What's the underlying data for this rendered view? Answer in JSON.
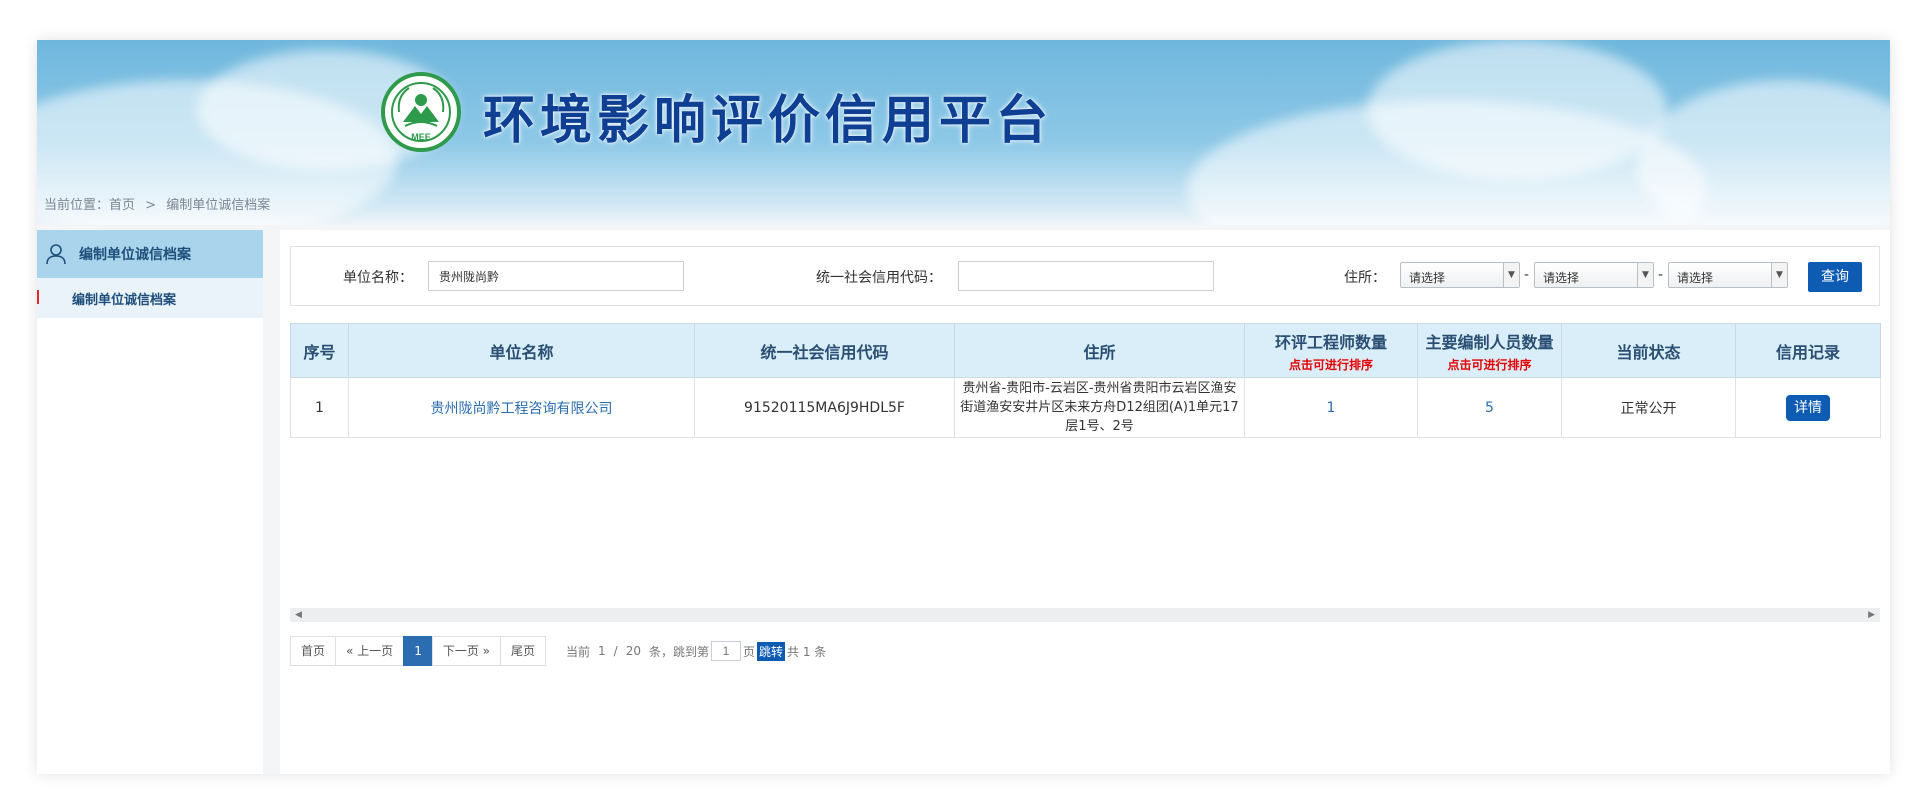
{
  "banner": {
    "title": "环境影响评价信用平台",
    "logo_text": "MEE"
  },
  "breadcrumb": {
    "prefix": "当前位置：",
    "home": "首页",
    "separator": ">",
    "current": "编制单位诚信档案"
  },
  "sidebar": {
    "header": "编制单位诚信档案",
    "items": [
      {
        "label": "编制单位诚信档案"
      }
    ]
  },
  "filter": {
    "unit_name_label": "单位名称：",
    "unit_name_value": "贵州陇尚黔",
    "credit_code_label": "统一社会信用代码：",
    "credit_code_value": "",
    "address_label": "住所：",
    "province": "请选择",
    "city": "请选择",
    "district": "请选择",
    "dash": "-",
    "query_label": "查询"
  },
  "table": {
    "headers": {
      "index": "序号",
      "name": "单位名称",
      "credit_code": "统一社会信用代码",
      "address": "住所",
      "engineers": "环评工程师数量",
      "engineers_hint": "点击可进行排序",
      "staff": "主要编制人员数量",
      "staff_hint": "点击可进行排序",
      "status": "当前状态",
      "record": "信用记录"
    },
    "rows": [
      {
        "index": "1",
        "name": "贵州陇尚黔工程咨询有限公司",
        "credit_code": "91520115MA6J9HDL5F",
        "address": "贵州省-贵阳市-云岩区-贵州省贵阳市云岩区渔安街道渔安安井片区未来方舟D12组团(A)1单元17层1号、2号",
        "engineers": "1",
        "staff": "5",
        "status": "正常公开",
        "action": "详情"
      }
    ]
  },
  "pagination": {
    "first": "首页",
    "prev": "« 上一页",
    "current_page": "1",
    "next": "下一页 »",
    "last": "尾页",
    "current_label": "当前",
    "page_value": "1",
    "slash": "/",
    "per_page": "20",
    "per_page_suffix": "条，跳到第",
    "jump_value": "1",
    "page_suffix": "页",
    "jump_label": "跳转",
    "total_label": "共 1 条"
  },
  "colors": {
    "primary": "#0e5bb4",
    "link": "#2c6cb0",
    "title": "#0f3f93",
    "header_bg": "#d9eef9",
    "sort_hint": "#e60000",
    "logo_green": "#2e9a4b"
  }
}
